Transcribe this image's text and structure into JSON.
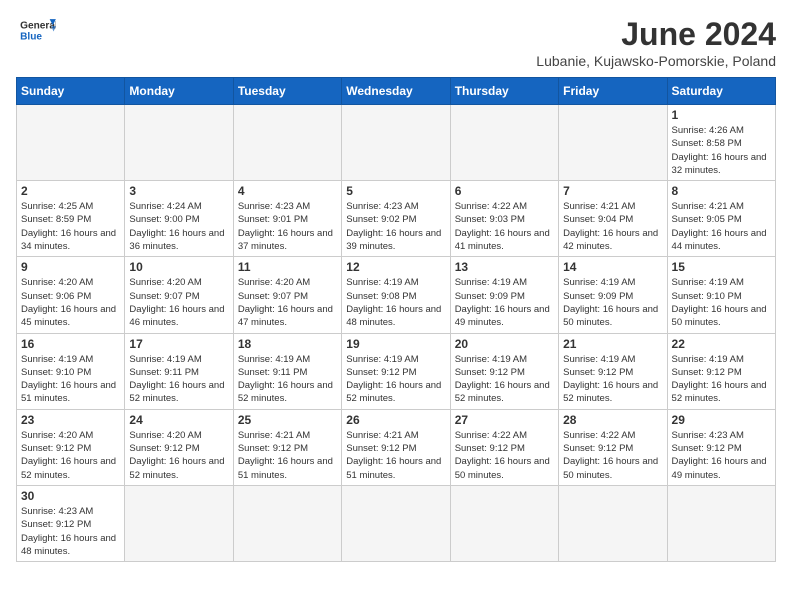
{
  "header": {
    "logo_general": "General",
    "logo_blue": "Blue",
    "month_title": "June 2024",
    "subtitle": "Lubanie, Kujawsko-Pomorskie, Poland"
  },
  "days_of_week": [
    "Sunday",
    "Monday",
    "Tuesday",
    "Wednesday",
    "Thursday",
    "Friday",
    "Saturday"
  ],
  "weeks": [
    {
      "days": [
        {
          "num": "",
          "info": ""
        },
        {
          "num": "",
          "info": ""
        },
        {
          "num": "",
          "info": ""
        },
        {
          "num": "",
          "info": ""
        },
        {
          "num": "",
          "info": ""
        },
        {
          "num": "",
          "info": ""
        },
        {
          "num": "1",
          "info": "Sunrise: 4:26 AM\nSunset: 8:58 PM\nDaylight: 16 hours and 32 minutes."
        }
      ]
    },
    {
      "days": [
        {
          "num": "2",
          "info": "Sunrise: 4:25 AM\nSunset: 8:59 PM\nDaylight: 16 hours and 34 minutes."
        },
        {
          "num": "3",
          "info": "Sunrise: 4:24 AM\nSunset: 9:00 PM\nDaylight: 16 hours and 36 minutes."
        },
        {
          "num": "4",
          "info": "Sunrise: 4:23 AM\nSunset: 9:01 PM\nDaylight: 16 hours and 37 minutes."
        },
        {
          "num": "5",
          "info": "Sunrise: 4:23 AM\nSunset: 9:02 PM\nDaylight: 16 hours and 39 minutes."
        },
        {
          "num": "6",
          "info": "Sunrise: 4:22 AM\nSunset: 9:03 PM\nDaylight: 16 hours and 41 minutes."
        },
        {
          "num": "7",
          "info": "Sunrise: 4:21 AM\nSunset: 9:04 PM\nDaylight: 16 hours and 42 minutes."
        },
        {
          "num": "8",
          "info": "Sunrise: 4:21 AM\nSunset: 9:05 PM\nDaylight: 16 hours and 44 minutes."
        }
      ]
    },
    {
      "days": [
        {
          "num": "9",
          "info": "Sunrise: 4:20 AM\nSunset: 9:06 PM\nDaylight: 16 hours and 45 minutes."
        },
        {
          "num": "10",
          "info": "Sunrise: 4:20 AM\nSunset: 9:07 PM\nDaylight: 16 hours and 46 minutes."
        },
        {
          "num": "11",
          "info": "Sunrise: 4:20 AM\nSunset: 9:07 PM\nDaylight: 16 hours and 47 minutes."
        },
        {
          "num": "12",
          "info": "Sunrise: 4:19 AM\nSunset: 9:08 PM\nDaylight: 16 hours and 48 minutes."
        },
        {
          "num": "13",
          "info": "Sunrise: 4:19 AM\nSunset: 9:09 PM\nDaylight: 16 hours and 49 minutes."
        },
        {
          "num": "14",
          "info": "Sunrise: 4:19 AM\nSunset: 9:09 PM\nDaylight: 16 hours and 50 minutes."
        },
        {
          "num": "15",
          "info": "Sunrise: 4:19 AM\nSunset: 9:10 PM\nDaylight: 16 hours and 50 minutes."
        }
      ]
    },
    {
      "days": [
        {
          "num": "16",
          "info": "Sunrise: 4:19 AM\nSunset: 9:10 PM\nDaylight: 16 hours and 51 minutes."
        },
        {
          "num": "17",
          "info": "Sunrise: 4:19 AM\nSunset: 9:11 PM\nDaylight: 16 hours and 52 minutes."
        },
        {
          "num": "18",
          "info": "Sunrise: 4:19 AM\nSunset: 9:11 PM\nDaylight: 16 hours and 52 minutes."
        },
        {
          "num": "19",
          "info": "Sunrise: 4:19 AM\nSunset: 9:12 PM\nDaylight: 16 hours and 52 minutes."
        },
        {
          "num": "20",
          "info": "Sunrise: 4:19 AM\nSunset: 9:12 PM\nDaylight: 16 hours and 52 minutes."
        },
        {
          "num": "21",
          "info": "Sunrise: 4:19 AM\nSunset: 9:12 PM\nDaylight: 16 hours and 52 minutes."
        },
        {
          "num": "22",
          "info": "Sunrise: 4:19 AM\nSunset: 9:12 PM\nDaylight: 16 hours and 52 minutes."
        }
      ]
    },
    {
      "days": [
        {
          "num": "23",
          "info": "Sunrise: 4:20 AM\nSunset: 9:12 PM\nDaylight: 16 hours and 52 minutes."
        },
        {
          "num": "24",
          "info": "Sunrise: 4:20 AM\nSunset: 9:12 PM\nDaylight: 16 hours and 52 minutes."
        },
        {
          "num": "25",
          "info": "Sunrise: 4:21 AM\nSunset: 9:12 PM\nDaylight: 16 hours and 51 minutes."
        },
        {
          "num": "26",
          "info": "Sunrise: 4:21 AM\nSunset: 9:12 PM\nDaylight: 16 hours and 51 minutes."
        },
        {
          "num": "27",
          "info": "Sunrise: 4:22 AM\nSunset: 9:12 PM\nDaylight: 16 hours and 50 minutes."
        },
        {
          "num": "28",
          "info": "Sunrise: 4:22 AM\nSunset: 9:12 PM\nDaylight: 16 hours and 50 minutes."
        },
        {
          "num": "29",
          "info": "Sunrise: 4:23 AM\nSunset: 9:12 PM\nDaylight: 16 hours and 49 minutes."
        }
      ]
    },
    {
      "days": [
        {
          "num": "30",
          "info": "Sunrise: 4:23 AM\nSunset: 9:12 PM\nDaylight: 16 hours and 48 minutes."
        },
        {
          "num": "",
          "info": ""
        },
        {
          "num": "",
          "info": ""
        },
        {
          "num": "",
          "info": ""
        },
        {
          "num": "",
          "info": ""
        },
        {
          "num": "",
          "info": ""
        },
        {
          "num": "",
          "info": ""
        }
      ]
    }
  ]
}
